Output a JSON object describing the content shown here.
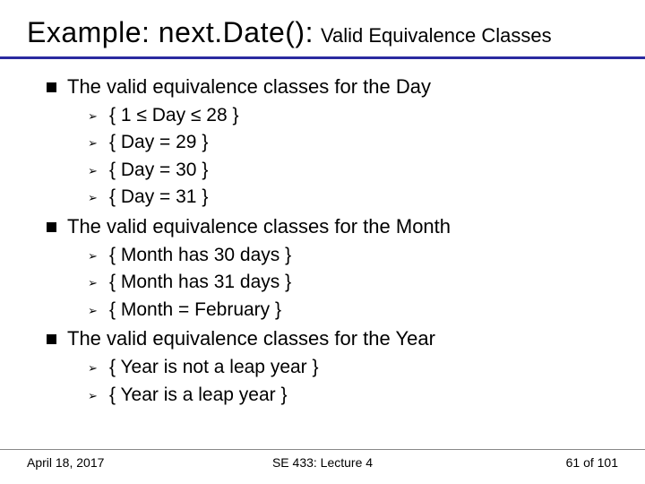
{
  "title": {
    "main": "Example: next.Date():",
    "sub": "Valid Equivalence Classes"
  },
  "sections": [
    {
      "heading": "The valid equivalence classes for the Day",
      "items": [
        "{ 1 ≤ Day ≤ 28 }",
        "{ Day = 29 }",
        "{ Day = 30 }",
        "{ Day = 31 }"
      ]
    },
    {
      "heading": "The valid equivalence classes for the Month",
      "items": [
        "{ Month has 30 days }",
        "{ Month has 31 days }",
        "{ Month = February }"
      ]
    },
    {
      "heading": "The valid equivalence classes for the Year",
      "items": [
        "{ Year is not a leap year }",
        "{ Year is a leap year }"
      ]
    }
  ],
  "footer": {
    "date": "April 18, 2017",
    "course": "SE 433: Lecture 4",
    "page": "61 of 101"
  },
  "glyphs": {
    "arrow": "➢"
  }
}
